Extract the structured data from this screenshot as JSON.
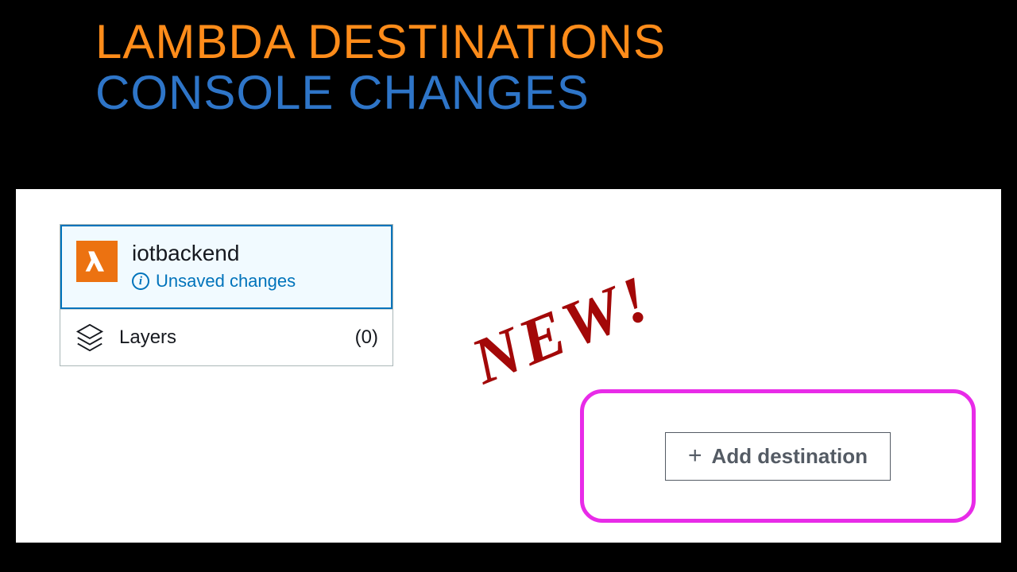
{
  "title": {
    "line1": "LAMBDA DESTINATIONS",
    "line2": "CONSOLE CHANGES"
  },
  "function": {
    "name": "iotbackend",
    "status": "Unsaved changes",
    "icon": "lambda-icon"
  },
  "layers": {
    "label": "Layers",
    "count": "(0)",
    "icon": "layers-icon"
  },
  "annotation": "NEW!",
  "add_destination": {
    "label": "Add destination",
    "plus": "+"
  },
  "colors": {
    "title_orange": "#ff8c1a",
    "title_blue": "#2e75c8",
    "aws_blue": "#0073bb",
    "aws_orange": "#ec7211",
    "highlight_pink": "#e82be8",
    "annotation_red": "#a30808"
  }
}
